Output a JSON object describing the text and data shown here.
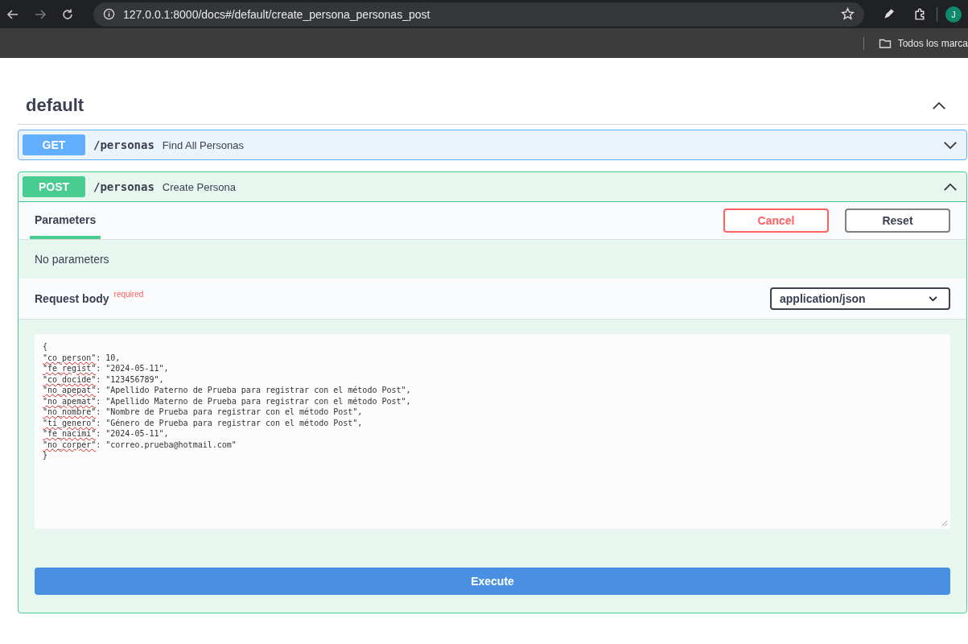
{
  "browser": {
    "url": "127.0.0.1:8000/docs#/default/create_persona_personas_post",
    "avatar": "J",
    "bookmark": "Todos los marca"
  },
  "section": {
    "title": "default",
    "expanded": true
  },
  "operations": [
    {
      "method": "GET",
      "path": "/personas",
      "summary": "Find All Personas",
      "expanded": false
    },
    {
      "method": "POST",
      "path": "/personas",
      "summary": "Create Persona",
      "expanded": true
    }
  ],
  "tabs": [
    {
      "label": "Parameters",
      "selected": true
    }
  ],
  "buttons": {
    "cancel": "Cancel",
    "reset": "Reset",
    "execute": "Execute"
  },
  "no_parameters": "No parameters",
  "request_body": {
    "label": "Request body",
    "required": "required",
    "content_type": "application/json"
  },
  "body": {
    "open": "{",
    "close": "}",
    "lines": [
      {
        "key": "\"co_person\"",
        "rest": ": 10,"
      },
      {
        "key": "\"fe_regist\"",
        "rest": ": \"2024-05-11\","
      },
      {
        "key": "\"co_docide\"",
        "rest": ": \"123456789\","
      },
      {
        "key": "\"no_apepat\"",
        "rest": ": \"Apellido Paterno de Prueba para registrar con el método Post\","
      },
      {
        "key": "\"no_apemat\"",
        "rest": ": \"Apellido Materno de Prueba para registrar con el método Post\","
      },
      {
        "key": "\"no_nombre\"",
        "rest": ": \"Nombre de Prueba para registrar con el método Post\","
      },
      {
        "key": "\"ti_genero\"",
        "rest": ": \"Género de Prueba para registrar con el método Post\","
      },
      {
        "key": "\"fe_nacimi\"",
        "rest": ": \"2024-05-11\","
      },
      {
        "key": "\"no_corper\"",
        "rest": ": \"correo.prueba@hotmail.com\""
      }
    ]
  }
}
